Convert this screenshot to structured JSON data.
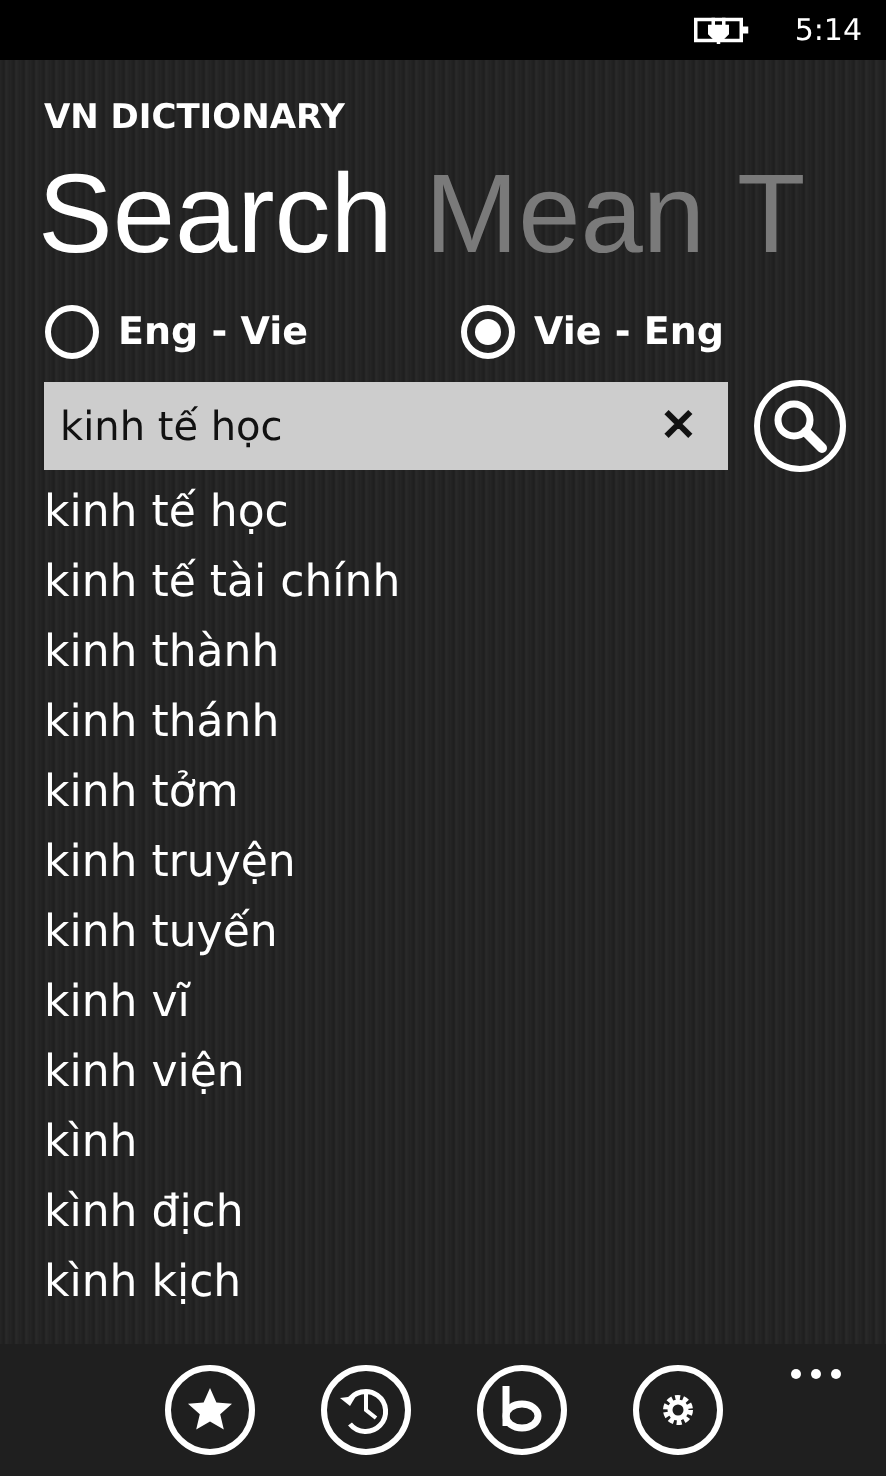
{
  "status_bar": {
    "time": "5:14"
  },
  "app_title": "VN DICTIONARY",
  "pivot": [
    {
      "label": "Search",
      "selected": true
    },
    {
      "label": "Mean",
      "selected": false
    },
    {
      "label": "T",
      "selected": false
    }
  ],
  "directions": [
    {
      "label": "Eng - Vie",
      "selected": false
    },
    {
      "label": "Vie - Eng",
      "selected": true
    }
  ],
  "search": {
    "value": "kinh tế học",
    "clear": "✕"
  },
  "results": [
    "kinh tế học",
    "kinh tế tài chính",
    "kinh thành",
    "kinh thánh",
    "kinh tởm",
    "kinh truyện",
    "kinh tuyến",
    "kinh vĩ",
    "kinh viện",
    "kình",
    "kình địch",
    "kình kịch"
  ],
  "app_bar": {
    "buttons": [
      {
        "kind": "star"
      },
      {
        "kind": "history"
      },
      {
        "kind": "bing"
      },
      {
        "kind": "settings"
      }
    ]
  }
}
